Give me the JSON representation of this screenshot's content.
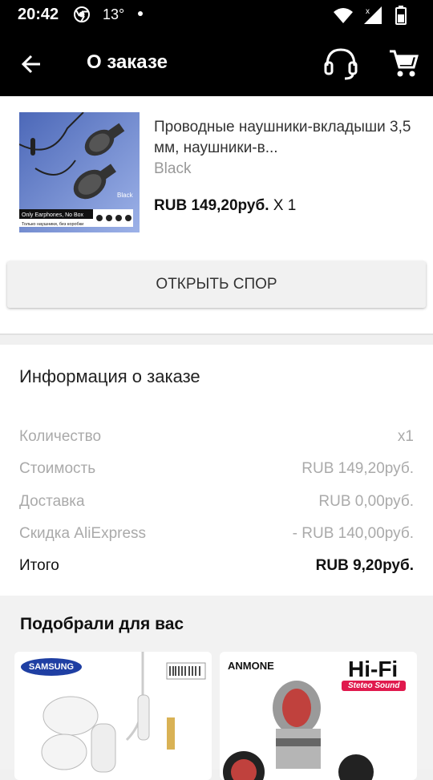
{
  "status_bar": {
    "time": "20:42",
    "temperature": "13°"
  },
  "app_bar": {
    "title": "О заказе"
  },
  "product": {
    "name": "Проводные наушники-вкладыши 3,5 мм, наушники-в...",
    "variant": "Black",
    "price": "RUB 149,20руб.",
    "quantity": "X 1",
    "image_labels": {
      "tag": "Black",
      "caption": "Only Earphones, No Box",
      "caption_ru": "Только наушники, без коробки"
    }
  },
  "dispute_button": "ОТКРЫТЬ СПОР",
  "order_info": {
    "title": "Информация о заказе",
    "rows": [
      {
        "label": "Количество",
        "value": "x1"
      },
      {
        "label": "Стоимость",
        "value": "RUB 149,20руб."
      },
      {
        "label": "Доставка",
        "value": "RUB 0,00руб."
      },
      {
        "label": "Скидка AliExpress",
        "value": "- RUB 140,00руб."
      },
      {
        "label": "Итого",
        "value": "RUB 9,20руб."
      }
    ]
  },
  "recommendations": {
    "title": "Подобрали для вас",
    "items": [
      {
        "brand": "SAMSUNG"
      },
      {
        "brand": "ANMONE",
        "headline": "Hi-Fi",
        "badge": "Steteo Sound"
      }
    ]
  },
  "colors": {
    "bar_background": "#000000",
    "page_background": "#f0f0f0",
    "card_background": "#ffffff",
    "muted_text": "#aaaaaa"
  }
}
